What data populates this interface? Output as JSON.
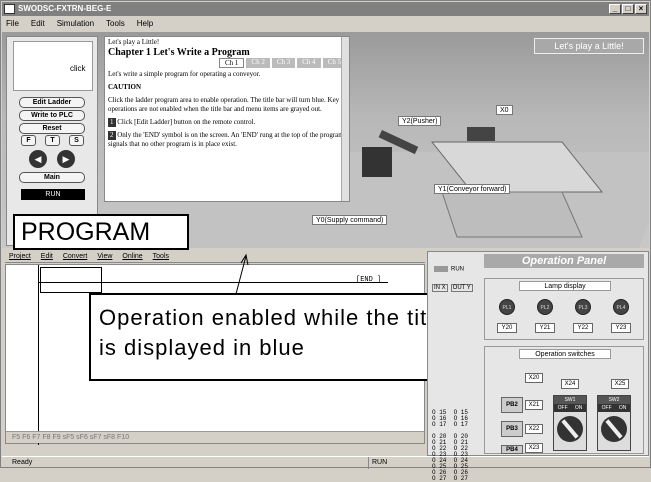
{
  "window": {
    "title": "SWODSC-FXTRN-BEG-E",
    "controls": [
      "_",
      "□",
      "×"
    ]
  },
  "menu": [
    "File",
    "Edit",
    "Simulation",
    "Tools",
    "Help"
  ],
  "remote": {
    "click_label": "click",
    "buttons": [
      "Edit Ladder",
      "Write to PLC",
      "Reset"
    ],
    "fts": [
      "F",
      "T",
      "S"
    ],
    "main": "Main",
    "run": "RUN"
  },
  "help": {
    "intro": "Let's play a Little!",
    "chapter": "Chapter 1  Let's Write a Program",
    "tabs": [
      "Ch 1",
      "Ch 2",
      "Ch 3",
      "Ch 4",
      "Ch 5"
    ],
    "p1": "Let's write a simple program for operating a conveyor.",
    "caution_title": "CAUTION",
    "caution": "Click the ladder program area to enable operation. The title bar will turn blue. Key operations are not enabled when the title bar and menu items are grayed out.",
    "step1_num": "1",
    "step1": "Click [Edit Ladder] button on the remote control.",
    "step2_num": "2",
    "step2": "Only the 'END' symbol is on the screen. An 'END' rung at the top of the program signals that no other program is in place exist."
  },
  "scene": {
    "title": "Let's play a Little!",
    "labels": [
      "Y2(Pusher)",
      "X0",
      "Y1(Conveyor forward)",
      "Y0(Supply command)"
    ]
  },
  "program_label": "PROGRAM",
  "ladder": {
    "menu": [
      "Project",
      "Edit",
      "Convert",
      "View",
      "Online",
      "Tools"
    ],
    "end": "[END ]",
    "toolbar": "F5  F6  F7  F8  F9  sF5  sF6  sF7  sF8  F10"
  },
  "callout": "Operation enabled while the title bar is displayed in blue",
  "statusbar": {
    "ready": "Ready",
    "run": "RUN"
  },
  "panel": {
    "title": "Operation Panel",
    "run": "RUN",
    "in": "IN X",
    "out": "OUT Y",
    "io_list": "O 15  O 15\nO 16  O 16\nO 17  O 17\n\nO 20  O 20\nO 21  O 21\nO 22  O 22\nO 23  O 23\nO 24  O 24\nO 25  O 25\nO 26  O 26\nO 27  O 27",
    "lamp_header": "Lamp display",
    "lamps": [
      "PL1",
      "PL2",
      "PL3",
      "PL4"
    ],
    "lamp_addrs": [
      "Y20",
      "Y21",
      "Y22",
      "Y23"
    ],
    "switch_header": "Operation switches",
    "pbs": [
      "PB2",
      "PB3",
      "PB4"
    ],
    "pb_addrs": [
      "X20",
      "X21",
      "X22",
      "X23"
    ],
    "sw_addrs": [
      "X24",
      "X25"
    ],
    "switches": [
      "SW1",
      "SW2"
    ],
    "off": "OFF",
    "on": "ON"
  }
}
